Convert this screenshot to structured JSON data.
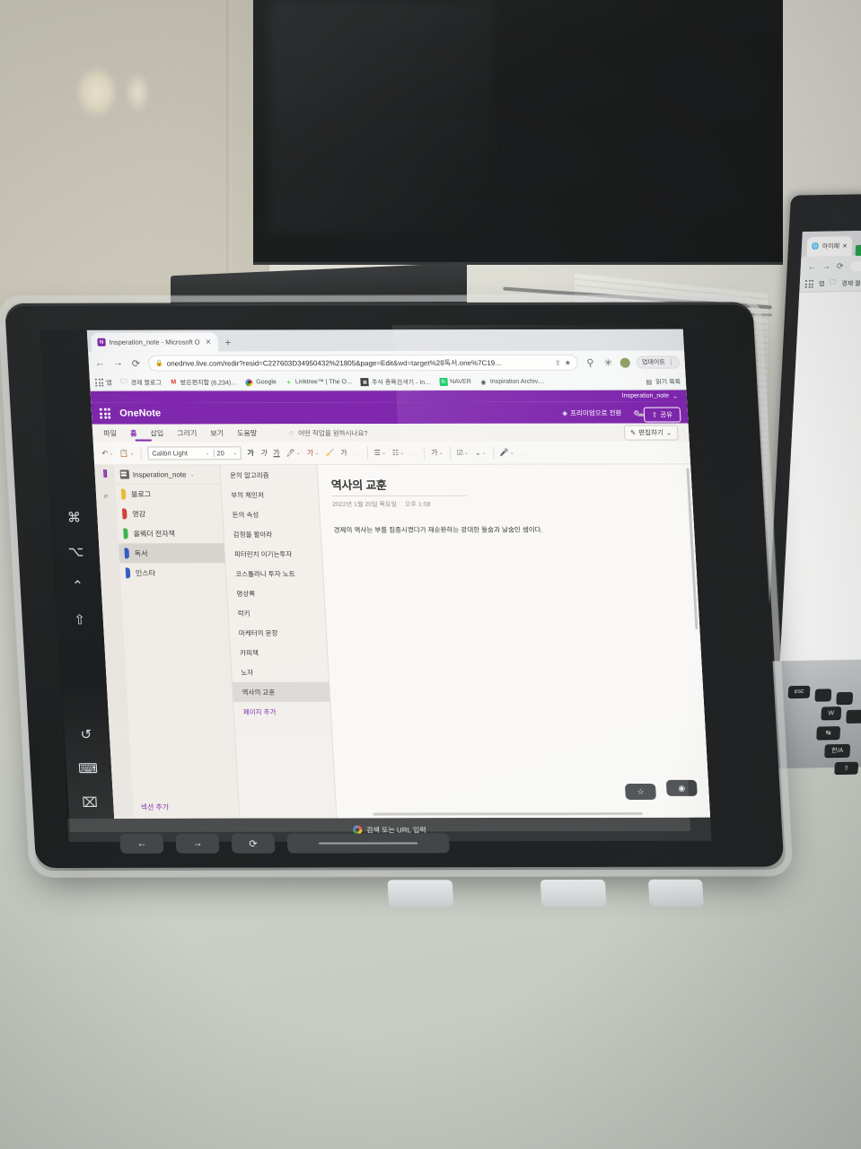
{
  "browser": {
    "tab": {
      "title": "Insperation_note - Microsoft O",
      "close_label": "✕",
      "favicon": "onenote-icon"
    },
    "new_tab_label": "+",
    "nav": {
      "back": "←",
      "forward": "→",
      "reload": "⟳"
    },
    "omnibox": {
      "lock": "🔒",
      "url": "onedrive.live.com/redir?resid=C227603D34950432%21805&page=Edit&wd=target%28독서.one%7C19…",
      "share_icon": "share-icon",
      "star_icon": "★"
    },
    "toolbar_icons": [
      "extension-icon",
      "cast-icon",
      "profile-avatar"
    ],
    "profile_pill_label": "업데이트",
    "reading_list_label": "읽기 목록",
    "bookmarks": [
      {
        "label": "앱",
        "icon": "apps-grid-icon"
      },
      {
        "label": "경제 블로그",
        "icon": "folder-icon"
      },
      {
        "label": "받은편지함 (6,234)…",
        "icon": "gmail-icon"
      },
      {
        "label": "Google",
        "icon": "google-icon"
      },
      {
        "label": "Linktree™ | The O…",
        "icon": "linktree-icon"
      },
      {
        "label": "주식 종목검색기 - In…",
        "icon": "chart-icon"
      },
      {
        "label": "NAVER",
        "icon": "naver-icon"
      },
      {
        "label": "Inspiration Archiv…",
        "icon": "globe-icon"
      }
    ]
  },
  "onenote": {
    "notebook_title_top": "Insperation_note",
    "app_name": "OneNote",
    "premium_label": "프리미엄으로 전환",
    "top_icons": [
      "gear-icon",
      "bell-icon",
      "account-icon"
    ],
    "share_label": "공유",
    "ribbon_tabs": [
      {
        "label": "파일",
        "active": false
      },
      {
        "label": "홈",
        "active": true
      },
      {
        "label": "삽입",
        "active": false
      },
      {
        "label": "그리기",
        "active": false
      },
      {
        "label": "보기",
        "active": false
      },
      {
        "label": "도움말",
        "active": false
      }
    ],
    "tell_me_placeholder": "어떤 작업을 원하시나요?",
    "edit_button_label": "편집하기",
    "ribbon": {
      "undo_icon": "undo-icon",
      "clipboard_icon": "clipboard-icon",
      "font_name": "Calibri Light",
      "font_size": "20",
      "bold": "가",
      "italic": "가",
      "underline": "가",
      "highlight_icon": "highlighter-icon",
      "font_color": "가",
      "clear_format_icon": "clear-formatting-icon",
      "style_icon": "가",
      "more_icon": "…",
      "bullets_icon": "bullet-list-icon",
      "numbering_icon": "numbered-list-icon",
      "more_icon2": "…",
      "styles_icon": "가",
      "tag_icon": "tag-star-icon",
      "dictate_icon": "dictate-icon",
      "microphone_icon": "microphone-icon",
      "overflow_icon": "…"
    },
    "rail": {
      "notebook_icon": "notebooks-icon",
      "search_icon": "search-icon"
    },
    "notebook_header": "Insperation_note",
    "sections": [
      {
        "label": "블로그",
        "color": "#e8b923",
        "active": false
      },
      {
        "label": "영감",
        "color": "#d0342c",
        "active": false
      },
      {
        "label": "올웨더 전자책",
        "color": "#2fb344",
        "active": false
      },
      {
        "label": "독서",
        "color": "#2a52be",
        "active": true
      },
      {
        "label": "인스타",
        "color": "#2a52be",
        "active": false
      }
    ],
    "add_section_label": "섹션 추가",
    "pages": [
      {
        "label": "운의 알고리즘",
        "active": false
      },
      {
        "label": "부의 체인저",
        "active": false
      },
      {
        "label": "돈의 속성",
        "active": false
      },
      {
        "label": "감정을 팔아라",
        "active": false
      },
      {
        "label": "피터린치 이기는투자",
        "active": false
      },
      {
        "label": "코스톨라니 투자 노트",
        "active": false
      },
      {
        "label": "명상록",
        "active": false
      },
      {
        "label": "럭키",
        "active": false
      },
      {
        "label": "마케터의 문장",
        "active": false
      },
      {
        "label": "카피책",
        "active": false
      },
      {
        "label": "노자",
        "active": false
      },
      {
        "label": "역사의 교훈",
        "active": true
      }
    ],
    "add_page_label": "페이지 추가",
    "page": {
      "title": "역사의 교훈",
      "date": "2022년 1월 20일 목요일",
      "time": "오후 1:08",
      "body": "경제의 역사는 부를 집중시켰다가 재순환하는 광대한 들숨과 날숨인 셈이다."
    }
  },
  "tablet": {
    "system_keys": [
      "command-icon",
      "option-icon",
      "control-icon",
      "shift-icon",
      "undo-icon",
      "keyboard-icon",
      "hide-keyboard-icon"
    ],
    "search_bar_placeholder": "검색 또는 URL 입력",
    "nav_buttons": [
      "back-icon",
      "forward-icon",
      "reload-icon",
      "home-indicator"
    ],
    "float_buttons": [
      "star-icon",
      "assistant-icon"
    ]
  },
  "macbook": {
    "tab_title": "아이패",
    "bookmarks": [
      "앱",
      "경제 블로그"
    ],
    "keys": [
      "esc",
      "W",
      "한/A",
      "⇧"
    ]
  },
  "colors": {
    "onenote_purple": "#7719aa",
    "chrome_grey": "#dee1e6",
    "desk": "#cfd3cb"
  }
}
